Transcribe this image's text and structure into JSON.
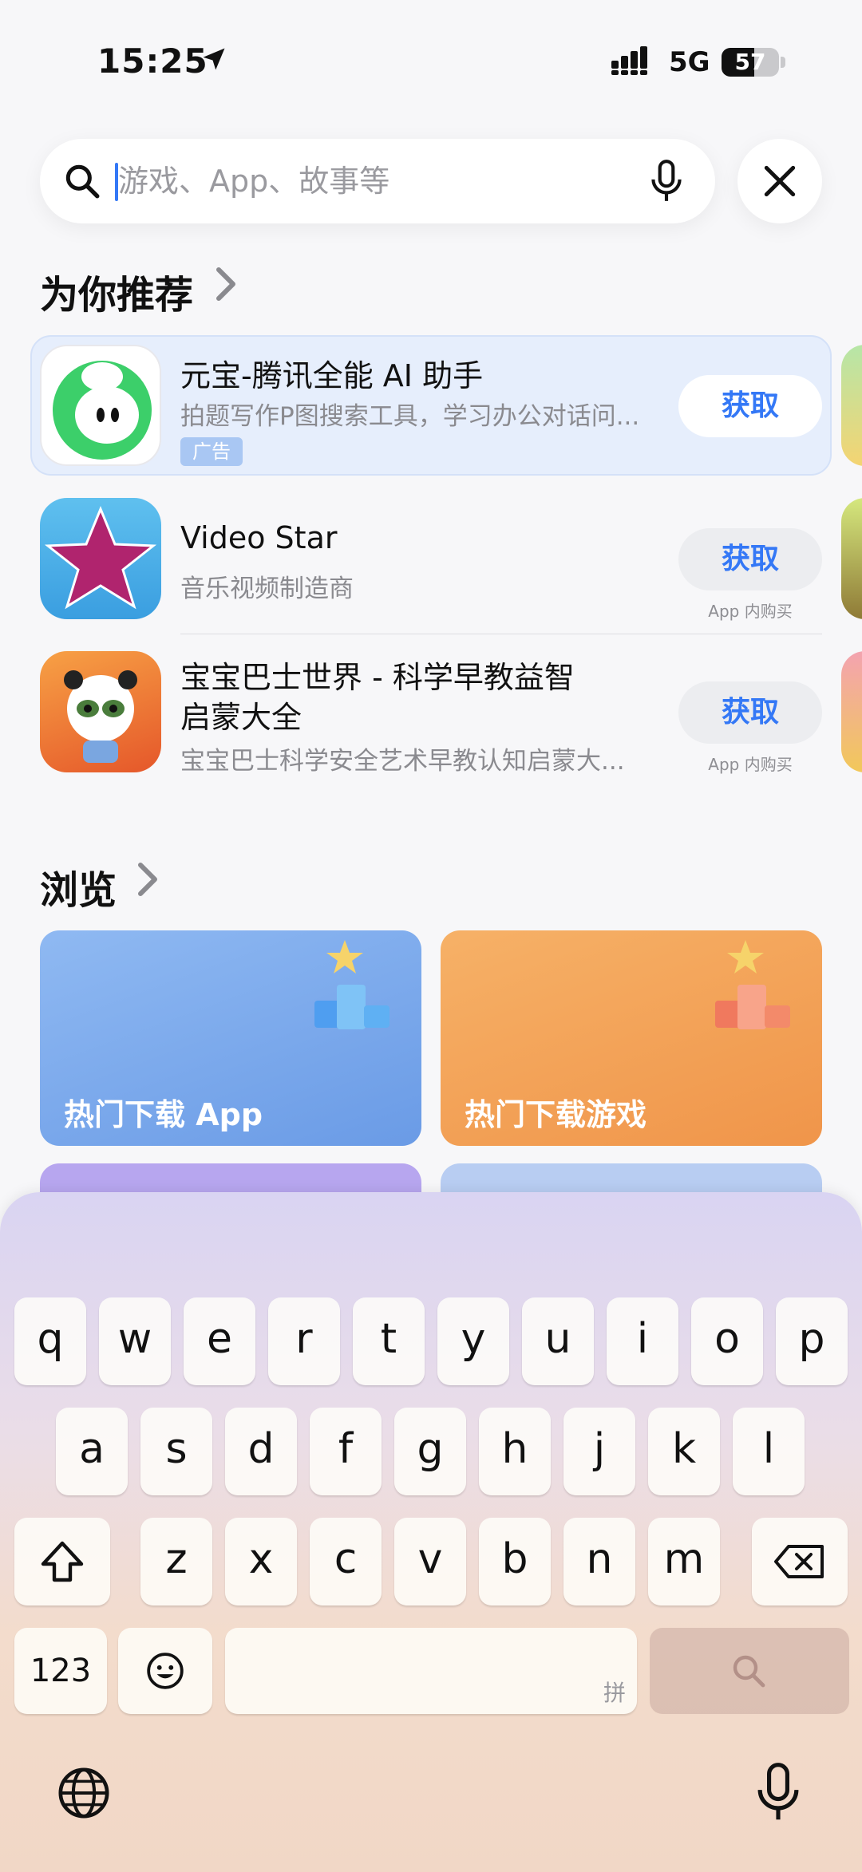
{
  "status_bar": {
    "time": "15:25",
    "network": "5G",
    "battery": "57",
    "battery_level_percent": 57
  },
  "search": {
    "placeholder": "游戏、App、故事等",
    "value": ""
  },
  "recommended": {
    "title": "为你推荐",
    "apps": [
      {
        "name": "元宝-腾讯全能 AI 助手",
        "subtitle": "拍题写作P图搜索工具，学习办公对话问...",
        "ad_label": "广告",
        "button": "获取",
        "icon": "yuanbao-icon"
      },
      {
        "name": "Video Star",
        "subtitle": "音乐视频制造商",
        "button": "获取",
        "iap": "App 内购买",
        "icon": "video-star-icon"
      },
      {
        "name_line1": "宝宝巴士世界 - 科学早教益智",
        "name_line2": "启蒙大全",
        "subtitle": "宝宝巴士科学安全艺术早教认知启蒙大...",
        "button": "获取",
        "iap": "App 内购买",
        "icon": "babybus-icon"
      }
    ]
  },
  "browse": {
    "title": "浏览",
    "cards": [
      {
        "label": "热门下载 App",
        "color": "#6f9ee8"
      },
      {
        "label": "热门下载游戏",
        "color": "#f0954a"
      }
    ]
  },
  "keyboard": {
    "row1": [
      "q",
      "w",
      "e",
      "r",
      "t",
      "y",
      "u",
      "i",
      "o",
      "p"
    ],
    "row2": [
      "a",
      "s",
      "d",
      "f",
      "g",
      "h",
      "j",
      "k",
      "l"
    ],
    "row3": [
      "z",
      "x",
      "c",
      "v",
      "b",
      "n",
      "m"
    ],
    "numbers_key": "123",
    "space_hint": "拼",
    "icons": [
      "shift-icon",
      "delete-icon",
      "emoji-icon",
      "globe-icon",
      "dictation-icon",
      "search-icon"
    ]
  },
  "colors": {
    "accent": "#3478f6",
    "ad_row_bg": "#e6eefc"
  }
}
